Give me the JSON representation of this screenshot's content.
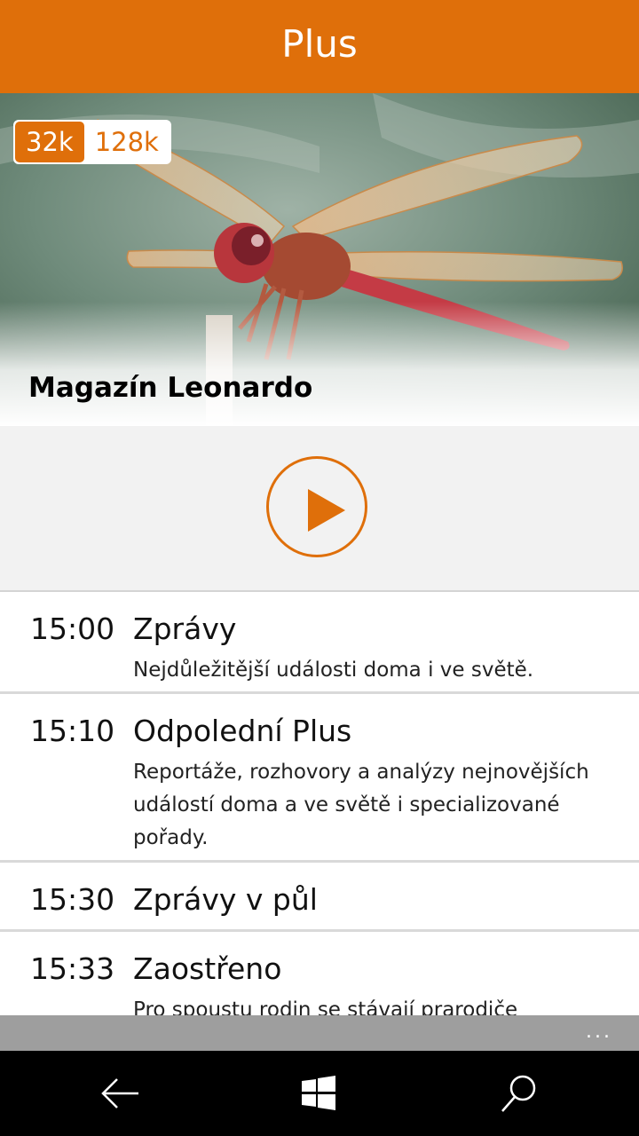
{
  "header": {
    "title": "Plus"
  },
  "hero": {
    "show_title": "Magazín Leonardo",
    "bitrate_options": [
      {
        "label": "32k",
        "selected": true
      },
      {
        "label": "128k",
        "selected": false
      }
    ]
  },
  "player": {
    "state": "paused"
  },
  "schedule": [
    {
      "time": "15:00",
      "title": "Zprávy",
      "description": "Nejdůležitější události doma i ve světě."
    },
    {
      "time": "15:10",
      "title": "Odpolední Plus",
      "description": "Reportáže, rozhovory a analýzy nejnovějších událostí doma a ve světě i specializované pořady."
    },
    {
      "time": "15:30",
      "title": "Zprávy v půl",
      "description": ""
    },
    {
      "time": "15:33",
      "title": "Zaostřeno",
      "description": "Pro spoustu rodin se stávají prarodiče"
    }
  ],
  "appbar": {
    "more_label": "..."
  },
  "navbar": {
    "icons": [
      "back-arrow-icon",
      "windows-logo-icon",
      "search-icon"
    ]
  },
  "colors": {
    "accent": "#df6f0a",
    "appbar": "#9e9e9e",
    "navbar": "#000000"
  }
}
